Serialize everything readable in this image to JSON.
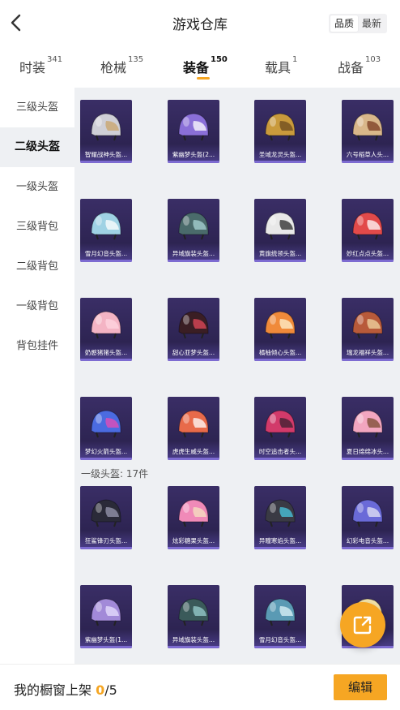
{
  "header": {
    "title": "游戏仓库",
    "sort_options": [
      {
        "label": "品质",
        "active": true
      },
      {
        "label": "最新",
        "active": false
      }
    ]
  },
  "tabs": [
    {
      "label": "时装",
      "count": "341",
      "active": false
    },
    {
      "label": "枪械",
      "count": "135",
      "active": false
    },
    {
      "label": "装备",
      "count": "150",
      "active": true
    },
    {
      "label": "载具",
      "count": "1",
      "active": false
    },
    {
      "label": "战备",
      "count": "103",
      "active": false
    }
  ],
  "sidebar": {
    "items": [
      {
        "label": "三级头盔",
        "active": false
      },
      {
        "label": "二级头盔",
        "active": true
      },
      {
        "label": "一级头盔",
        "active": false
      },
      {
        "label": "三级背包",
        "active": false
      },
      {
        "label": "二级背包",
        "active": false
      },
      {
        "label": "一级背包",
        "active": false
      },
      {
        "label": "背包挂件",
        "active": false
      }
    ]
  },
  "items": [
    {
      "name": "智耀战神头盔...",
      "color": "#cfcfd6",
      "accent": "#c9a46a"
    },
    {
      "name": "紫幽梦头盔(2...",
      "color": "#8a6fd8",
      "accent": "#ffffff"
    },
    {
      "name": "圣域龙灵头盔...",
      "color": "#c99a3c",
      "accent": "#6b4a1e"
    },
    {
      "name": "六号稻草人头...",
      "color": "#d9b78a",
      "accent": "#7a3b20"
    },
    {
      "name": "雪月幻音头盔...",
      "color": "#9fd2e4",
      "accent": "#ffffff"
    },
    {
      "name": "异域旗装头盔...",
      "color": "#4a6b6b",
      "accent": "#a9d6d6"
    },
    {
      "name": "黄旗统领头盔...",
      "color": "#e8e8e8",
      "accent": "#2a2a2a"
    },
    {
      "name": "妙红点点头盔...",
      "color": "#e24a4a",
      "accent": "#ffffff"
    },
    {
      "name": "奶憨猪猪头盔...",
      "color": "#f4b4c4",
      "accent": "#ffd6e0"
    },
    {
      "name": "甜心亚梦头盔...",
      "color": "#3a1e24",
      "accent": "#e44a5a"
    },
    {
      "name": "橘柚倾心头盔...",
      "color": "#f08a3a",
      "accent": "#fff1d0"
    },
    {
      "name": "瑞龙福祥头盔...",
      "color": "#b85a3a",
      "accent": "#f2d7a3"
    },
    {
      "name": "梦幻火箭头盔...",
      "color": "#4b6be0",
      "accent": "#e94bb4"
    },
    {
      "name": "虎虎生威头盔...",
      "color": "#e86a4a",
      "accent": "#ffffff"
    },
    {
      "name": "时空追击者头...",
      "color": "#d23a6a",
      "accent": "#3a2030"
    },
    {
      "name": "夏日绵绵冰头...",
      "color": "#f2a6c0",
      "accent": "#7a4a30"
    },
    {
      "name": "狂鲨锋刃头盔...",
      "color": "#2a2a38",
      "accent": "#9a9ab0"
    },
    {
      "name": "炫彩糖果头盔...",
      "color": "#f08ab8",
      "accent": "#f5e3c0"
    },
    {
      "name": "异瞳寒焰头盔...",
      "color": "#3a3a44",
      "accent": "#4ac8e0"
    },
    {
      "name": "幻彩电音头盔...",
      "color": "#6a6ad8",
      "accent": "#e6e6f6"
    },
    {
      "name": "紫幽梦头盔(1...",
      "color": "#a28ad8",
      "accent": "#e8e0ff"
    },
    {
      "name": "异域旗装头盔...",
      "color": "#3a5a5a",
      "accent": "#9ad0d0"
    },
    {
      "name": "雪月幻音头盔...",
      "color": "#5a9ab4",
      "accent": "#e0f4fa"
    },
    {
      "name": "",
      "color": "#f2e2a8",
      "accent": "#ffffff"
    }
  ],
  "section": {
    "label": "一级头盔: 17件"
  },
  "bottom": {
    "shelf_label": "我的橱窗上架",
    "shelf_current": "0",
    "shelf_total": "/5",
    "edit_label": "编辑"
  },
  "colors": {
    "accent": "#f6a623",
    "card_bg": "#2d2452",
    "card_bottom": "#7d6bd1"
  }
}
